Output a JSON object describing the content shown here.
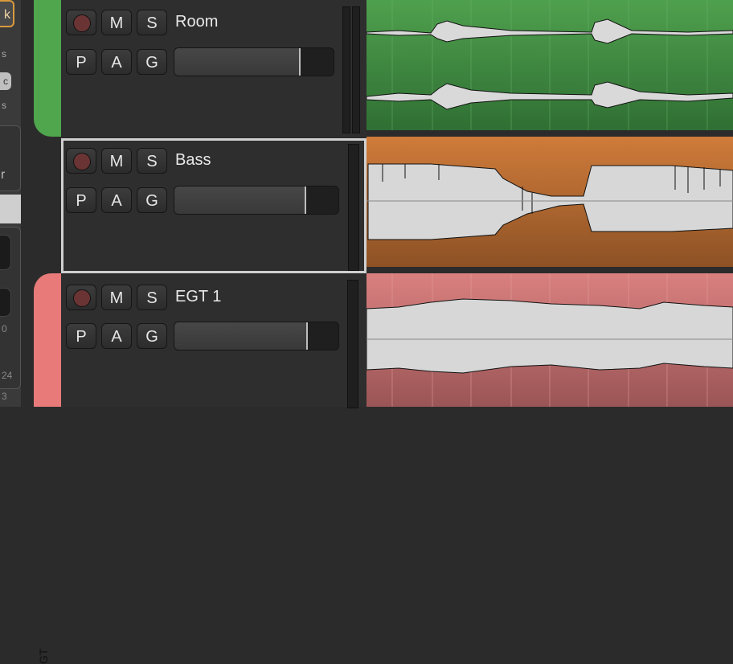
{
  "left_panel": {
    "top_button_label": "k",
    "texts": [
      "s",
      "c",
      "s",
      "r",
      "0",
      "24",
      "3"
    ]
  },
  "tracks": [
    {
      "name": "Room",
      "color": "#4fa64d",
      "rec_label": "",
      "mute_label": "M",
      "solo_label": "S",
      "p_label": "P",
      "a_label": "A",
      "g_label": "G",
      "volume": 0.71
    },
    {
      "name": "Bass",
      "color": "#c87a3a",
      "rec_label": "",
      "mute_label": "M",
      "solo_label": "S",
      "p_label": "P",
      "a_label": "A",
      "g_label": "G",
      "volume": 0.76
    },
    {
      "name": "EGT 1",
      "color": "#e87b79",
      "rec_label": "",
      "mute_label": "M",
      "solo_label": "S",
      "p_label": "P",
      "a_label": "A",
      "g_label": "G",
      "volume": 0.76
    }
  ],
  "colors": {
    "room_region": "#3f8a42",
    "bass_region": "#bf7036",
    "egt_region": "#c56a6c",
    "waveform_fill": "#d7d7d7",
    "selected_border": "#d0d0d0"
  },
  "vertical_tab_text": "GT"
}
